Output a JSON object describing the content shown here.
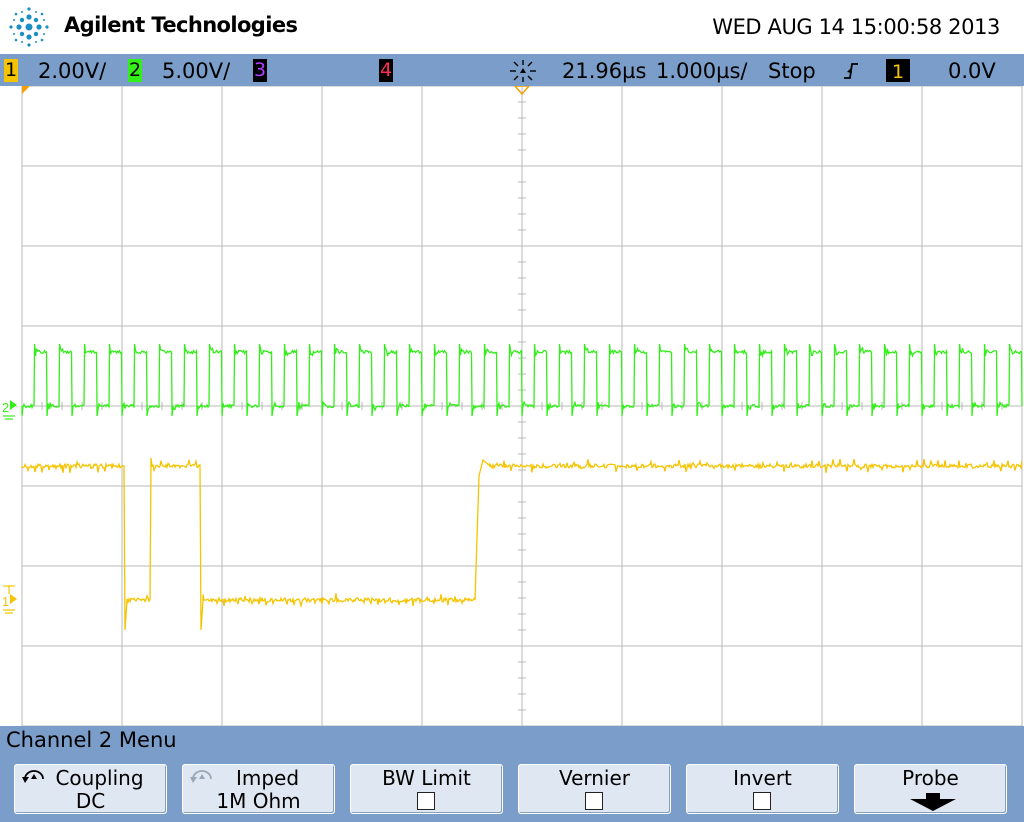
{
  "header": {
    "brand": "Agilent Technologies",
    "datetime": "WED AUG 14 15:00:58 2013"
  },
  "status": {
    "ch1_num": "1",
    "ch1_scale": "2.00V/",
    "ch2_num": "2",
    "ch2_scale": "5.00V/",
    "ch3_num": "3",
    "ch4_num": "4",
    "time_delay": "21.96µs",
    "time_scale": "1.000µs/",
    "run_state": "Stop",
    "trigger_source": "1",
    "trigger_level": "0.0V"
  },
  "colors": {
    "ch1": "#f5c400",
    "ch2": "#33ee1a",
    "ch3": "#b040ff",
    "ch4": "#ff2a5a",
    "bars": "#7a9ec9",
    "grid": "#b8b8b8"
  },
  "traces": {
    "ch2_marker": "2",
    "ch1_marker": "1"
  },
  "menu": {
    "title": "Channel 2  Menu",
    "coupling_label": "Coupling",
    "coupling_value": "DC",
    "imped_label": "Imped",
    "imped_value": "1M Ohm",
    "bwlimit_label": "BW Limit",
    "vernier_label": "Vernier",
    "invert_label": "Invert",
    "probe_label": "Probe"
  }
}
